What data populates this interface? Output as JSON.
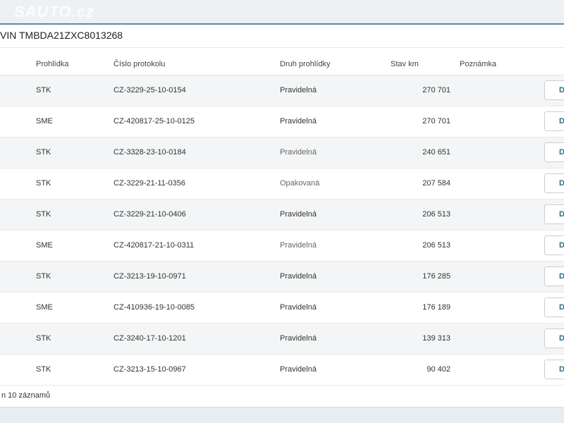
{
  "watermark": "SAUTO.cz",
  "panel": {
    "title": "VIN TMBDA21ZXC8013268"
  },
  "table": {
    "headers": {
      "inspection": "Prohlídka",
      "protocol": "Číslo protokolu",
      "type": "Druh prohlídky",
      "km": "Stav km",
      "note": "Poznámka"
    },
    "rows": [
      {
        "inspection": "STK",
        "protocol": "CZ-3229-25-10-0154",
        "type": "Pravidelná",
        "km": "270 701",
        "note": "",
        "action": "D"
      },
      {
        "inspection": "SME",
        "protocol": "CZ-420817-25-10-0125",
        "type": "Pravidelná",
        "km": "270 701",
        "note": "",
        "action": "D"
      },
      {
        "inspection": "STK",
        "protocol": "CZ-3328-23-10-0184",
        "type": "Pravidelná",
        "km": "240 651",
        "note": "",
        "action": "D"
      },
      {
        "inspection": "STK",
        "protocol": "CZ-3229-21-11-0356",
        "type": "Opakovaná",
        "km": "207 584",
        "note": "",
        "action": "D"
      },
      {
        "inspection": "STK",
        "protocol": "CZ-3229-21-10-0406",
        "type": "Pravidelná",
        "km": "206 513",
        "note": "",
        "action": "D"
      },
      {
        "inspection": "SME",
        "protocol": "CZ-420817-21-10-0311",
        "type": "Pravidelná",
        "km": "206 513",
        "note": "",
        "action": "D"
      },
      {
        "inspection": "STK",
        "protocol": "CZ-3213-19-10-0971",
        "type": "Pravidelná",
        "km": "176 285",
        "note": "",
        "action": "D"
      },
      {
        "inspection": "SME",
        "protocol": "CZ-410936-19-10-0085",
        "type": "Pravidelná",
        "km": "176 189",
        "note": "",
        "action": "D"
      },
      {
        "inspection": "STK",
        "protocol": "CZ-3240-17-10-1201",
        "type": "Pravidelná",
        "km": "139 313",
        "note": "",
        "action": "D"
      },
      {
        "inspection": "STK",
        "protocol": "CZ-3213-15-10-0967",
        "type": "Pravidelná",
        "km": "90 402",
        "note": "",
        "action": "D"
      }
    ]
  },
  "footer": {
    "info": "n 10 záznamů"
  }
}
